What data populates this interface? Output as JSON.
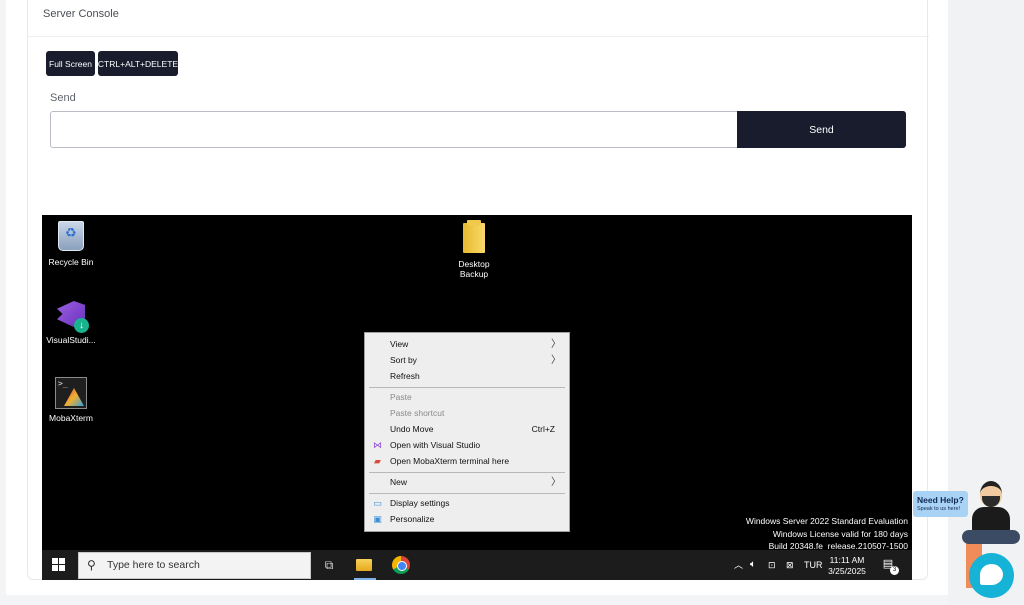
{
  "console": {
    "title": "Server Console",
    "fullscreen_label": "Full Screen",
    "cad_label": "CTRL+ALT+DELETE",
    "send_label": "Send",
    "send_input_value": "",
    "send_button_label": "Send"
  },
  "desktop": {
    "icons": {
      "recycle_bin": "Recycle Bin",
      "desktop_backup_line1": "Desktop",
      "desktop_backup_line2": "Backup",
      "visual_studio": "VisualStudi...",
      "mobaxterm": "MobaXterm"
    },
    "context_menu": {
      "view": "View",
      "sort_by": "Sort by",
      "refresh": "Refresh",
      "paste": "Paste",
      "paste_shortcut": "Paste shortcut",
      "undo_move": "Undo Move",
      "undo_shortcut": "Ctrl+Z",
      "open_vs": "Open with Visual Studio",
      "open_moba": "Open MobaXterm terminal here",
      "new": "New",
      "display_settings": "Display settings",
      "personalize": "Personalize"
    },
    "watermark": {
      "line1": "Windows Server 2022 Standard Evaluation",
      "line2": "Windows License valid for 180 days",
      "line3": "Build 20348.fe_release.210507-1500"
    },
    "taskbar": {
      "search_placeholder": "Type here to search",
      "language": "TUR",
      "time": "11:11 AM",
      "date": "3/25/2025",
      "notification_count": "3"
    }
  },
  "help_widget": {
    "title": "Need Help?",
    "subtitle": "Speak to us here!"
  },
  "colors": {
    "button_dark": "#181c2c",
    "chat_accent": "#17b3d6"
  }
}
